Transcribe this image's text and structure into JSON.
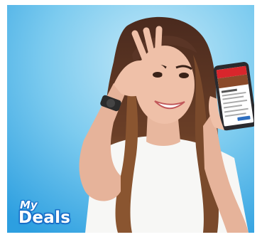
{
  "photo": {
    "subject": "woman-with-phone",
    "colors": {
      "background_top": "#a9dcf2",
      "background_bottom": "#2d9fe0",
      "hair": "#5a3526",
      "hair_tips": "#c98d55",
      "skin": "#efc0a8",
      "shirt": "#f7f7f5",
      "phone": "#2a2a2e",
      "app_header": "#d8262c"
    }
  },
  "logo": {
    "line1": "My",
    "line2": "Deals",
    "color": "#1a6fc8"
  }
}
